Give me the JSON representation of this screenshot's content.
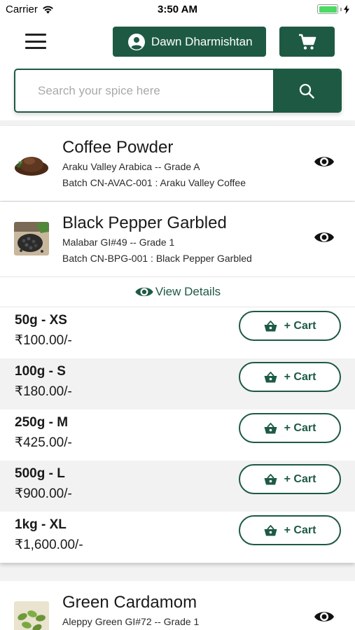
{
  "status_bar": {
    "carrier": "Carrier",
    "time": "3:50 AM"
  },
  "header": {
    "user_name": "Dawn Dharmishtan",
    "menu_icon": "hamburger-menu-icon",
    "cart_icon": "shopping-cart-icon",
    "user_icon": "user-circle-icon"
  },
  "search": {
    "placeholder": "Search your spice here",
    "value": "",
    "icon": "search-icon"
  },
  "colors": {
    "brand": "#1e5a43",
    "alt_row": "#f2f2f2"
  },
  "products": [
    {
      "name": "Coffee Powder",
      "subtitle": "Araku Valley Arabica -- Grade A",
      "batch": "Batch CN-AVAC-001 : Araku Valley Coffee",
      "thumb": "coffee-powder-thumbnail"
    },
    {
      "name": "Black Pepper Garbled",
      "subtitle": "Malabar GI#49 -- Grade 1",
      "batch": "Batch CN-BPG-001 : Black Pepper Garbled",
      "thumb": "black-pepper-thumbnail",
      "view_details_label": "View Details",
      "cart_label": "+ Cart",
      "variants": [
        {
          "size": "50g - XS",
          "price": "₹100.00/-"
        },
        {
          "size": "100g - S",
          "price": "₹180.00/-"
        },
        {
          "size": "250g - M",
          "price": "₹425.00/-"
        },
        {
          "size": "500g - L",
          "price": "₹900.00/-"
        },
        {
          "size": "1kg - XL",
          "price": "₹1,600.00/-"
        }
      ]
    },
    {
      "name": "Green Cardamom",
      "subtitle": "Aleppy Green GI#72 -- Grade 1",
      "thumb": "green-cardamom-thumbnail"
    }
  ]
}
